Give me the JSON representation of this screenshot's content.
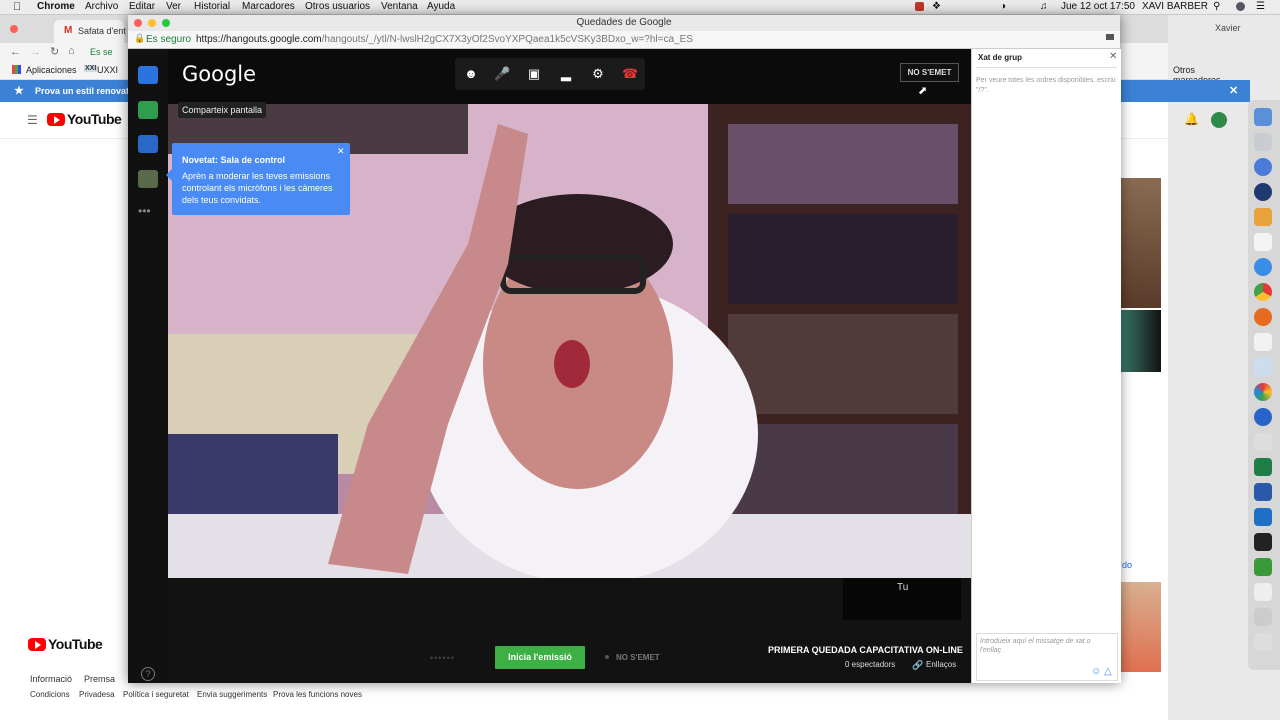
{
  "menubar": {
    "app": "Chrome",
    "items": [
      "Archivo",
      "Editar",
      "Ver",
      "Historial",
      "Marcadores",
      "Otros usuarios",
      "Ventana",
      "Ayuda"
    ],
    "datetime": "Jue 12 oct  17:50",
    "user": "XAVI BARBER"
  },
  "bg_browser": {
    "tab_label": "Safata d'ent",
    "profile": "Xavier",
    "addr_secure": "Es se",
    "bookmarks": [
      "Aplicaciones",
      "UXXI"
    ],
    "other_bookmarks": "Otros marcadores",
    "banner": "Prova un estil renovat",
    "youtube_logo": "YouTube",
    "footer_items": [
      "Informació",
      "Premsa"
    ],
    "footer_links": [
      "Condicions",
      "Privadesa",
      "Política i seguretat",
      "Envia suggeriments",
      "Prova les funcions noves"
    ],
    "side_link": "do"
  },
  "hangout": {
    "window_title": "Quedades de Google",
    "secure_label": "Es seguro",
    "url_host": "https://hangouts.google.com",
    "url_rest": "/hangouts/_/ytl/N-lwslH2gCX7X3yOf2SvoYXPQaea1k5cVSKy3BDxo_w=?hl=ca_ES",
    "logo": "Google",
    "no_emet": "NO S'EMET",
    "share_tooltip": "Comparteix pantalla",
    "promo": {
      "title": "Novetat: Sala de control",
      "body": "Aprèn a moderar les teves emissions controlant els micròfons i les càmeres dels teus convidats."
    },
    "self_label": "Tu",
    "start_button": "Inicia l'emissió",
    "status": "NO S'EMET",
    "event_title": "PRIMERA QUEDADA CAPACITATIVA ON-LINE",
    "viewers": "0 espectadors",
    "links": "Enllaços"
  },
  "chat": {
    "title": "Xat de grup",
    "hint": "Per veure totes les ordres disponibles, escriu \"/?\".",
    "placeholder": "Introdueix aquí el missatge de xat o l'enllaç"
  },
  "colors": {
    "promo_blue": "#4a8af4",
    "start_green": "#3cb044",
    "hangup_red": "#e53935"
  }
}
